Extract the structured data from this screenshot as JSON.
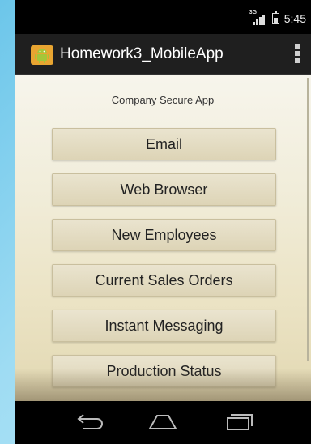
{
  "status_bar": {
    "time": "5:45",
    "network": "3G"
  },
  "action_bar": {
    "title": "Homework3_MobileApp"
  },
  "main": {
    "header": "Company Secure App",
    "buttons": [
      {
        "label": "Email"
      },
      {
        "label": "Web Browser"
      },
      {
        "label": "New Employees"
      },
      {
        "label": "Current Sales Orders"
      },
      {
        "label": "Instant Messaging"
      },
      {
        "label": "Production Status"
      }
    ]
  },
  "colors": {
    "accent": "#a4c639",
    "action_bar": "#1f1f1f",
    "button_bg": "#e3dbbf"
  },
  "icons": {
    "app": "android-robot-icon",
    "overflow": "overflow-menu-icon",
    "back": "back-icon",
    "home": "home-icon",
    "recents": "recents-icon"
  }
}
